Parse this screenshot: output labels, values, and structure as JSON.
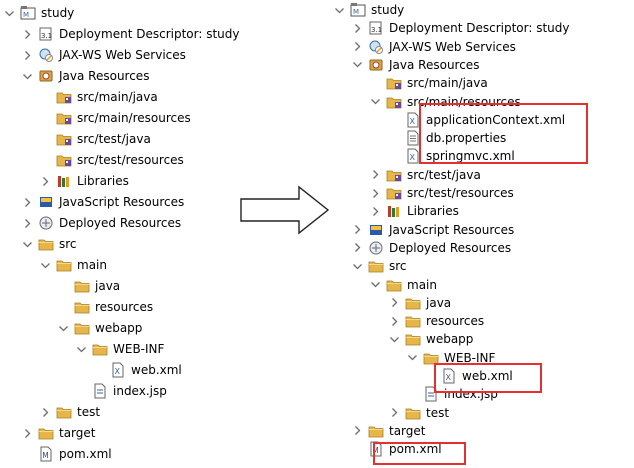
{
  "colors": {
    "folder": "#e6b64a",
    "highlight": "#e33131",
    "chevron": "#6d6d6d"
  },
  "left_tree": [
    {
      "label": "study",
      "icon": "project-icon",
      "toggle": "expanded"
    },
    {
      "label": "Deployment Descriptor: study",
      "icon": "deployment-descriptor-icon",
      "toggle": "collapsed"
    },
    {
      "label": "JAX-WS Web Services",
      "icon": "web-services-icon",
      "toggle": "collapsed"
    },
    {
      "label": "Java Resources",
      "icon": "java-resources-icon",
      "toggle": "expanded"
    },
    {
      "label": "src/main/java",
      "icon": "source-folder-icon",
      "toggle": "none"
    },
    {
      "label": "src/main/resources",
      "icon": "source-folder-icon",
      "toggle": "none"
    },
    {
      "label": "src/test/java",
      "icon": "source-folder-icon",
      "toggle": "none"
    },
    {
      "label": "src/test/resources",
      "icon": "source-folder-icon",
      "toggle": "none"
    },
    {
      "label": "Libraries",
      "icon": "libraries-icon",
      "toggle": "collapsed"
    },
    {
      "label": "JavaScript Resources",
      "icon": "javascript-resources-icon",
      "toggle": "collapsed"
    },
    {
      "label": "Deployed Resources",
      "icon": "deployed-resources-icon",
      "toggle": "collapsed"
    },
    {
      "label": "src",
      "icon": "folder-icon",
      "toggle": "expanded"
    },
    {
      "label": "main",
      "icon": "folder-icon",
      "toggle": "expanded"
    },
    {
      "label": "java",
      "icon": "folder-icon",
      "toggle": "none"
    },
    {
      "label": "resources",
      "icon": "folder-icon",
      "toggle": "none"
    },
    {
      "label": "webapp",
      "icon": "folder-icon",
      "toggle": "expanded"
    },
    {
      "label": "WEB-INF",
      "icon": "folder-icon",
      "toggle": "expanded"
    },
    {
      "label": "web.xml",
      "icon": "xml-file-icon",
      "toggle": "none"
    },
    {
      "label": "index.jsp",
      "icon": "jsp-file-icon",
      "toggle": "none"
    },
    {
      "label": "test",
      "icon": "folder-icon",
      "toggle": "collapsed"
    },
    {
      "label": "target",
      "icon": "folder-icon",
      "toggle": "collapsed"
    },
    {
      "label": "pom.xml",
      "icon": "maven-file-icon",
      "toggle": "none"
    }
  ],
  "right_tree": [
    {
      "label": "study",
      "icon": "project-icon",
      "toggle": "expanded"
    },
    {
      "label": "Deployment Descriptor: study",
      "icon": "deployment-descriptor-icon",
      "toggle": "collapsed"
    },
    {
      "label": "JAX-WS Web Services",
      "icon": "web-services-icon",
      "toggle": "collapsed"
    },
    {
      "label": "Java Resources",
      "icon": "java-resources-icon",
      "toggle": "expanded"
    },
    {
      "label": "src/main/java",
      "icon": "source-folder-icon",
      "toggle": "none"
    },
    {
      "label": "src/main/resources",
      "icon": "source-folder-icon",
      "toggle": "expanded"
    },
    {
      "label": "applicationContext.xml",
      "icon": "xml-file-icon",
      "toggle": "none"
    },
    {
      "label": "db.properties",
      "icon": "properties-file-icon",
      "toggle": "none"
    },
    {
      "label": "springmvc.xml",
      "icon": "xml-file-icon",
      "toggle": "none"
    },
    {
      "label": "src/test/java",
      "icon": "source-folder-icon",
      "toggle": "collapsed"
    },
    {
      "label": "src/test/resources",
      "icon": "source-folder-icon",
      "toggle": "collapsed"
    },
    {
      "label": "Libraries",
      "icon": "libraries-icon",
      "toggle": "collapsed"
    },
    {
      "label": "JavaScript Resources",
      "icon": "javascript-resources-icon",
      "toggle": "collapsed"
    },
    {
      "label": "Deployed Resources",
      "icon": "deployed-resources-icon",
      "toggle": "collapsed"
    },
    {
      "label": "src",
      "icon": "folder-icon",
      "toggle": "expanded"
    },
    {
      "label": "main",
      "icon": "folder-icon",
      "toggle": "expanded"
    },
    {
      "label": "java",
      "icon": "folder-icon",
      "toggle": "collapsed"
    },
    {
      "label": "resources",
      "icon": "folder-icon",
      "toggle": "collapsed"
    },
    {
      "label": "webapp",
      "icon": "folder-icon",
      "toggle": "expanded"
    },
    {
      "label": "WEB-INF",
      "icon": "folder-icon",
      "toggle": "expanded"
    },
    {
      "label": "web.xml",
      "icon": "xml-file-icon",
      "toggle": "none"
    },
    {
      "label": "index.jsp",
      "icon": "jsp-file-icon",
      "toggle": "none"
    },
    {
      "label": "test",
      "icon": "folder-icon",
      "toggle": "collapsed"
    },
    {
      "label": "target",
      "icon": "folder-icon",
      "toggle": "collapsed"
    },
    {
      "label": "pom.xml",
      "icon": "maven-file-icon",
      "toggle": "none"
    }
  ]
}
